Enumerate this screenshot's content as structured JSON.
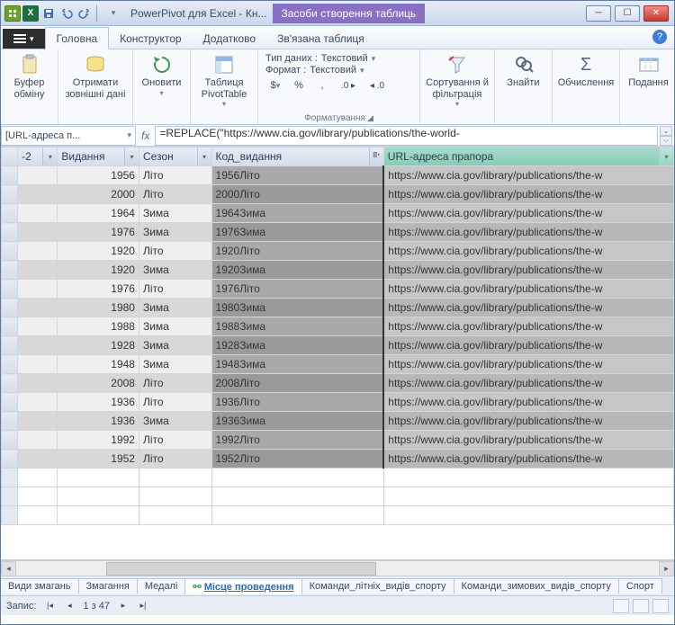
{
  "title": "PowerPivot для Excel - Кн...",
  "context_tab": "Засоби створення таблиць",
  "tabs": {
    "home": "Головна",
    "design": "Конструктор",
    "advanced": "Додатково",
    "linked": "Зв'язана таблиця"
  },
  "ribbon": {
    "clipboard": {
      "label": "Буфер обміну"
    },
    "getdata": {
      "label": "Отримати зовнішні дані"
    },
    "refresh": {
      "label": "Оновити"
    },
    "pivot": {
      "label": "Таблиця PivotTable"
    },
    "format_group": "Форматування",
    "datatype_lbl": "Тип даних :",
    "datatype_val": "Текстовий",
    "format_lbl": "Формат :",
    "format_val": "Текстовий",
    "currency_sym": "$",
    "percent_sym": "%",
    "comma_sym": ",",
    "dec_inc": ".0 ▸",
    "dec_dec": "◂ .0",
    "sortfilter": {
      "label": "Сортування й фільтрація"
    },
    "find": {
      "label": "Знайти"
    },
    "calc": {
      "label": "Обчислення"
    },
    "view": {
      "label": "Подання"
    }
  },
  "namebox": "[URL-адреса п...",
  "formula": "=REPLACE(\"https://www.cia.gov/library/publications/the-world-",
  "columns": {
    "c1": "-2",
    "c2": "Видання",
    "c3": "Сезон",
    "c4": "Код_видання",
    "c5": "URL-адреса прапора"
  },
  "rows": [
    {
      "y": "1956",
      "s": "Літо",
      "k": "1956Літо",
      "u": "https://www.cia.gov/library/publications/the-w"
    },
    {
      "y": "2000",
      "s": "Літо",
      "k": "2000Літо",
      "u": "https://www.cia.gov/library/publications/the-w"
    },
    {
      "y": "1964",
      "s": "Зима",
      "k": "1964Зима",
      "u": "https://www.cia.gov/library/publications/the-w"
    },
    {
      "y": "1976",
      "s": "Зима",
      "k": "1976Зима",
      "u": "https://www.cia.gov/library/publications/the-w"
    },
    {
      "y": "1920",
      "s": "Літо",
      "k": "1920Літо",
      "u": "https://www.cia.gov/library/publications/the-w"
    },
    {
      "y": "1920",
      "s": "Зима",
      "k": "1920Зима",
      "u": "https://www.cia.gov/library/publications/the-w"
    },
    {
      "y": "1976",
      "s": "Літо",
      "k": "1976Літо",
      "u": "https://www.cia.gov/library/publications/the-w"
    },
    {
      "y": "1980",
      "s": "Зима",
      "k": "1980Зима",
      "u": "https://www.cia.gov/library/publications/the-w"
    },
    {
      "y": "1988",
      "s": "Зима",
      "k": "1988Зима",
      "u": "https://www.cia.gov/library/publications/the-w"
    },
    {
      "y": "1928",
      "s": "Зима",
      "k": "1928Зима",
      "u": "https://www.cia.gov/library/publications/the-w"
    },
    {
      "y": "1948",
      "s": "Зима",
      "k": "1948Зима",
      "u": "https://www.cia.gov/library/publications/the-w"
    },
    {
      "y": "2008",
      "s": "Літо",
      "k": "2008Літо",
      "u": "https://www.cia.gov/library/publications/the-w"
    },
    {
      "y": "1936",
      "s": "Літо",
      "k": "1936Літо",
      "u": "https://www.cia.gov/library/publications/the-w"
    },
    {
      "y": "1936",
      "s": "Зима",
      "k": "1936Зима",
      "u": "https://www.cia.gov/library/publications/the-w"
    },
    {
      "y": "1992",
      "s": "Літо",
      "k": "1992Літо",
      "u": "https://www.cia.gov/library/publications/the-w"
    },
    {
      "y": "1952",
      "s": "Літо",
      "k": "1952Літо",
      "u": "https://www.cia.gov/library/publications/the-w"
    }
  ],
  "sheets": {
    "s1": "Види змагань",
    "s2": "Змагання",
    "s3": "Медалі",
    "s4": "Місце проведення",
    "s5": "Команди_літніх_видів_спорту",
    "s6": "Команди_зимових_видів_спорту",
    "s7": "Спорт"
  },
  "status": {
    "label": "Запис:",
    "pos": "1 з 47"
  }
}
